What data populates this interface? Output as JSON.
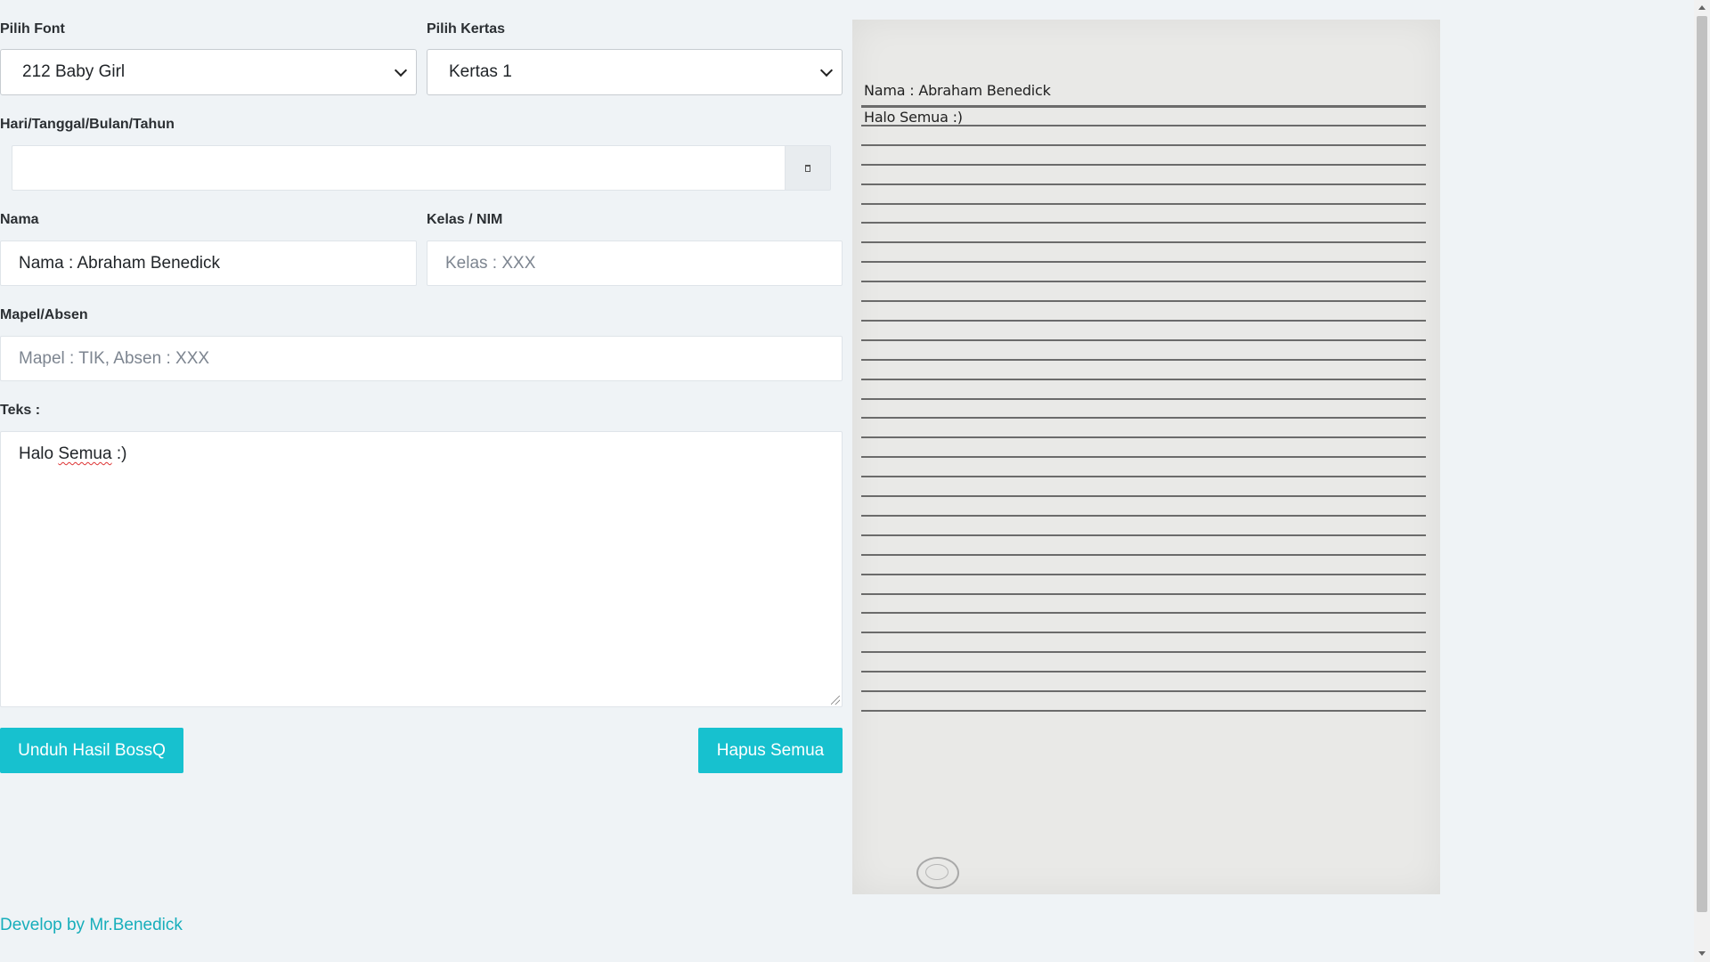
{
  "form": {
    "font_label": "Pilih Font",
    "font_selected": "212 Baby Girl",
    "paper_label": "Pilih Kertas",
    "paper_selected": "Kertas 1",
    "date_label": "Hari/Tanggal/Bulan/Tahun",
    "date_value": "",
    "date_icon": "calendar-icon",
    "name_label": "Nama",
    "name_value": "Nama : Abraham Benedick",
    "class_label": "Kelas / NIM",
    "class_placeholder": "Kelas : XXX",
    "subject_label": "Mapel/Absen",
    "subject_placeholder": "Mapel : TIK, Absen : XXX",
    "text_label": "Teks :",
    "text_word1": "Halo ",
    "text_word2": "Semua",
    "text_word3": " :)"
  },
  "buttons": {
    "download": "Unduh Hasil BossQ",
    "clear": "Hapus Semua"
  },
  "footer": {
    "credit": "Develop by Mr.Benedick"
  },
  "preview": {
    "name_line": "Nama : Abraham Benedick",
    "text_line": "Halo Semua :)"
  },
  "colors": {
    "accent": "#17c1cf",
    "background": "#eff3f6"
  }
}
